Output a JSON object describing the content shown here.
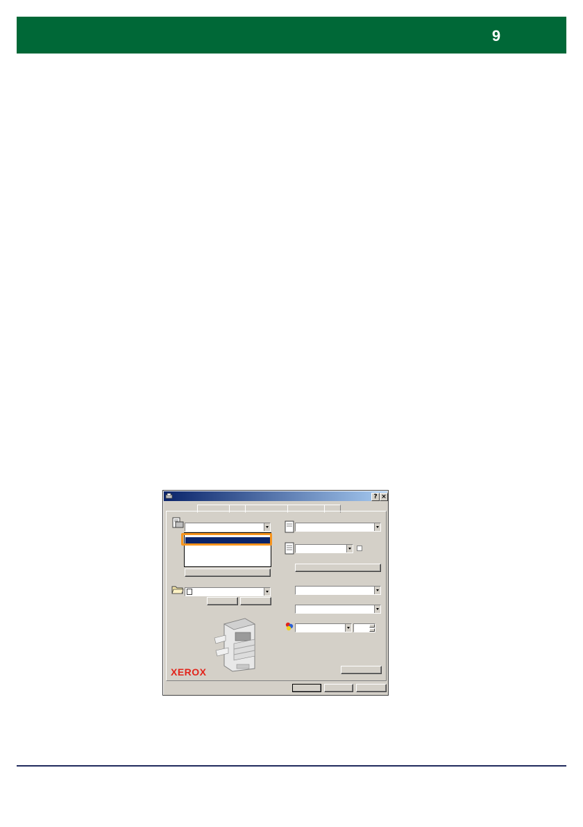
{
  "header": {
    "page_number": "9",
    "bar_color": "#006837"
  },
  "footer": {
    "rule_color": "#1f2a5c"
  },
  "dialog": {
    "title_icon": "printer-icon",
    "help_button_label": "?",
    "close_button_label": "×",
    "logo_text": "XEROX",
    "logo_color": "#e2231a",
    "highlight_color": "#f7941d",
    "icons": [
      "printer-icon",
      "folder-icon",
      "document-icon",
      "document-icon",
      "color-icon"
    ]
  }
}
